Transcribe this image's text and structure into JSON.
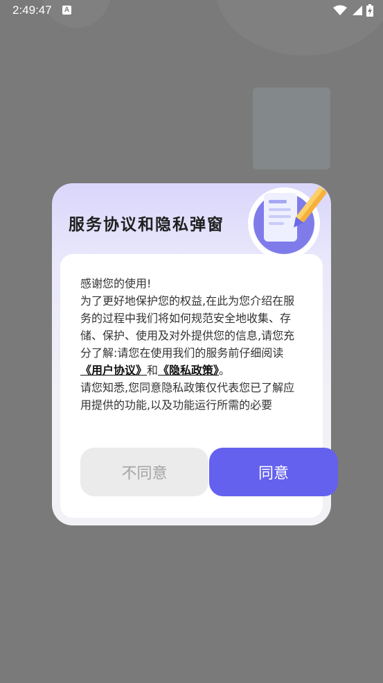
{
  "status_bar": {
    "time": "2:49:47",
    "notification_icon_letter": "A",
    "icons": [
      "wifi-icon",
      "signal-icon",
      "battery-charging-icon"
    ]
  },
  "dialog": {
    "title": "服务协议和隐私弹窗",
    "illustration_icon": "document-pencil-icon",
    "terms": {
      "greeting": "感谢您的使用!",
      "paragraph1_before": "为了更好地保护您的权益,在此为您介绍在服务的过程中我们将如何规范安全地收集、存储、保护、使用及对外提供您的信息,请您充分了解:请您在使用我们的服务前仔细阅读",
      "user_agreement_link": "《用户协议》",
      "and_text": "和",
      "privacy_policy_link": "《隐私政策》",
      "paragraph1_end": "。",
      "paragraph2": "请您知悉,您同意隐私政策仅代表您已了解应用提供的功能,以及功能运行所需的必要"
    },
    "buttons": {
      "disagree": "不同意",
      "agree": "同意"
    }
  },
  "colors": {
    "accent": "#6461ee",
    "overlay": "#7a7a7a",
    "disagree_bg": "#ebebeb"
  }
}
